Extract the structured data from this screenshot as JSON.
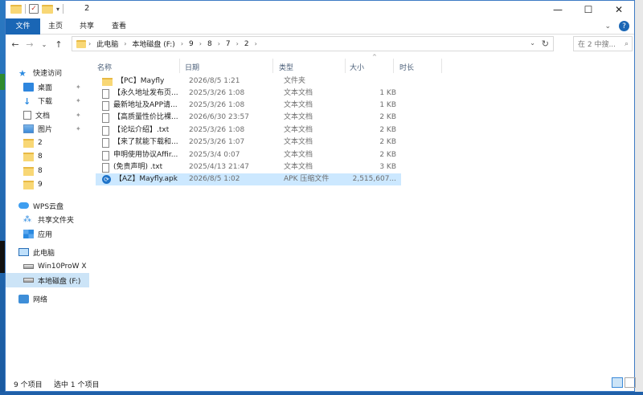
{
  "window": {
    "title": "2",
    "controls": [
      "minimize",
      "maximize",
      "close"
    ]
  },
  "ribbon": {
    "tabs": [
      "文件",
      "主页",
      "共享",
      "查看"
    ]
  },
  "address": {
    "breadcrumbs": [
      "此电脑",
      "本地磁盘 (F:)",
      "9",
      "8",
      "7",
      "2"
    ],
    "search_placeholder": "在 2 中搜..."
  },
  "sidebar": {
    "items": [
      {
        "label": "快速访问",
        "icon": "star-icon"
      },
      {
        "label": "桌面",
        "icon": "desktop-icon",
        "pinned": true
      },
      {
        "label": "下载",
        "icon": "download-icon",
        "pinned": true
      },
      {
        "label": "文档",
        "icon": "documents-icon",
        "pinned": true
      },
      {
        "label": "图片",
        "icon": "pictures-icon",
        "pinned": true
      },
      {
        "label": "2",
        "icon": "folder-icon"
      },
      {
        "label": "8",
        "icon": "folder-icon"
      },
      {
        "label": "8",
        "icon": "folder-icon"
      },
      {
        "label": "9",
        "icon": "folder-icon"
      },
      {
        "label": "WPS云盘",
        "icon": "cloud-icon"
      },
      {
        "label": "共享文件夹",
        "icon": "share-icon"
      },
      {
        "label": "应用",
        "icon": "apps-icon"
      },
      {
        "label": "此电脑",
        "icon": "computer-icon"
      },
      {
        "label": "Win10ProW X",
        "icon": "drive-icon"
      },
      {
        "label": "本地磁盘 (F:)",
        "icon": "drive-icon",
        "selected": true
      },
      {
        "label": "网络",
        "icon": "network-icon"
      }
    ]
  },
  "table": {
    "columns": [
      "名称",
      "日期",
      "类型",
      "大小",
      "时长"
    ],
    "rows": [
      {
        "name": "【PC】Mayfly",
        "date": "2026/8/5 1:21",
        "type": "文件夹",
        "size": "",
        "icon": "folder-icon"
      },
      {
        "name": "【永久地址发布页...",
        "date": "2025/3/26 1:08",
        "type": "文本文档",
        "size": "1 KB",
        "icon": "text-file-icon"
      },
      {
        "name": "最新地址及APP请...",
        "date": "2025/3/26 1:08",
        "type": "文本文档",
        "size": "1 KB",
        "icon": "text-file-icon"
      },
      {
        "name": "【高质量性价比裸...",
        "date": "2026/6/30 23:57",
        "type": "文本文档",
        "size": "2 KB",
        "icon": "text-file-icon"
      },
      {
        "name": "【论坛介绍】.txt",
        "date": "2025/3/26 1:08",
        "type": "文本文档",
        "size": "2 KB",
        "icon": "text-file-icon"
      },
      {
        "name": "【来了就能下载和...",
        "date": "2025/3/26 1:07",
        "type": "文本文档",
        "size": "2 KB",
        "icon": "text-file-icon"
      },
      {
        "name": "申明使用协议Affir...",
        "date": "2025/3/4 0:07",
        "type": "文本文档",
        "size": "2 KB",
        "icon": "text-file-icon"
      },
      {
        "name": "(免责声明) .txt",
        "date": "2025/4/13 21:47",
        "type": "文本文档",
        "size": "3 KB",
        "icon": "text-file-icon"
      },
      {
        "name": "【AZ】Mayfly.apk",
        "date": "2026/8/5 1:02",
        "type": "APK 压缩文件",
        "size": "2,515,607...",
        "icon": "apk-icon",
        "selected": true
      }
    ]
  },
  "status": {
    "count": "9 个项目",
    "selected": "选中 1 个项目"
  }
}
